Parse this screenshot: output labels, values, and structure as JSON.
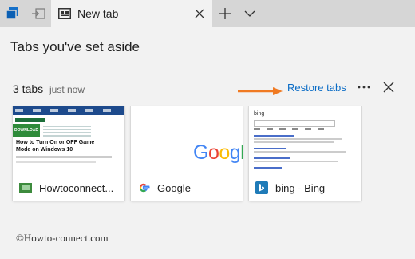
{
  "tabbar": {
    "active_tab_title": "New tab"
  },
  "panel": {
    "title": "Tabs you've set aside",
    "group": {
      "count_label": "3 tabs",
      "time_label": "just now",
      "restore_label": "Restore tabs"
    },
    "cards": [
      {
        "label": "Howtoconnect...",
        "thumb_headline": "How to Turn On or OFF Game Mode on Windows 10",
        "thumb_badge": "DOWNLOAD"
      },
      {
        "label": "Google",
        "thumb_logo": "Google"
      },
      {
        "label": "bing - Bing",
        "thumb_search": "bing"
      }
    ]
  },
  "watermark": "©Howto-connect.com",
  "colors": {
    "accent_link": "#0a6cc6",
    "annotation_arrow": "#f07a22",
    "tabstrip_bg": "#d6d6d6",
    "panel_bg": "#f2f2f2"
  },
  "icons": [
    "tabs-aside-icon",
    "set-tabs-aside-icon",
    "newtab-favicon-icon",
    "close-icon",
    "plus-icon",
    "chevron-down-icon",
    "more-icon",
    "google-g-icon",
    "bing-b-icon",
    "site-favicon-icon"
  ]
}
